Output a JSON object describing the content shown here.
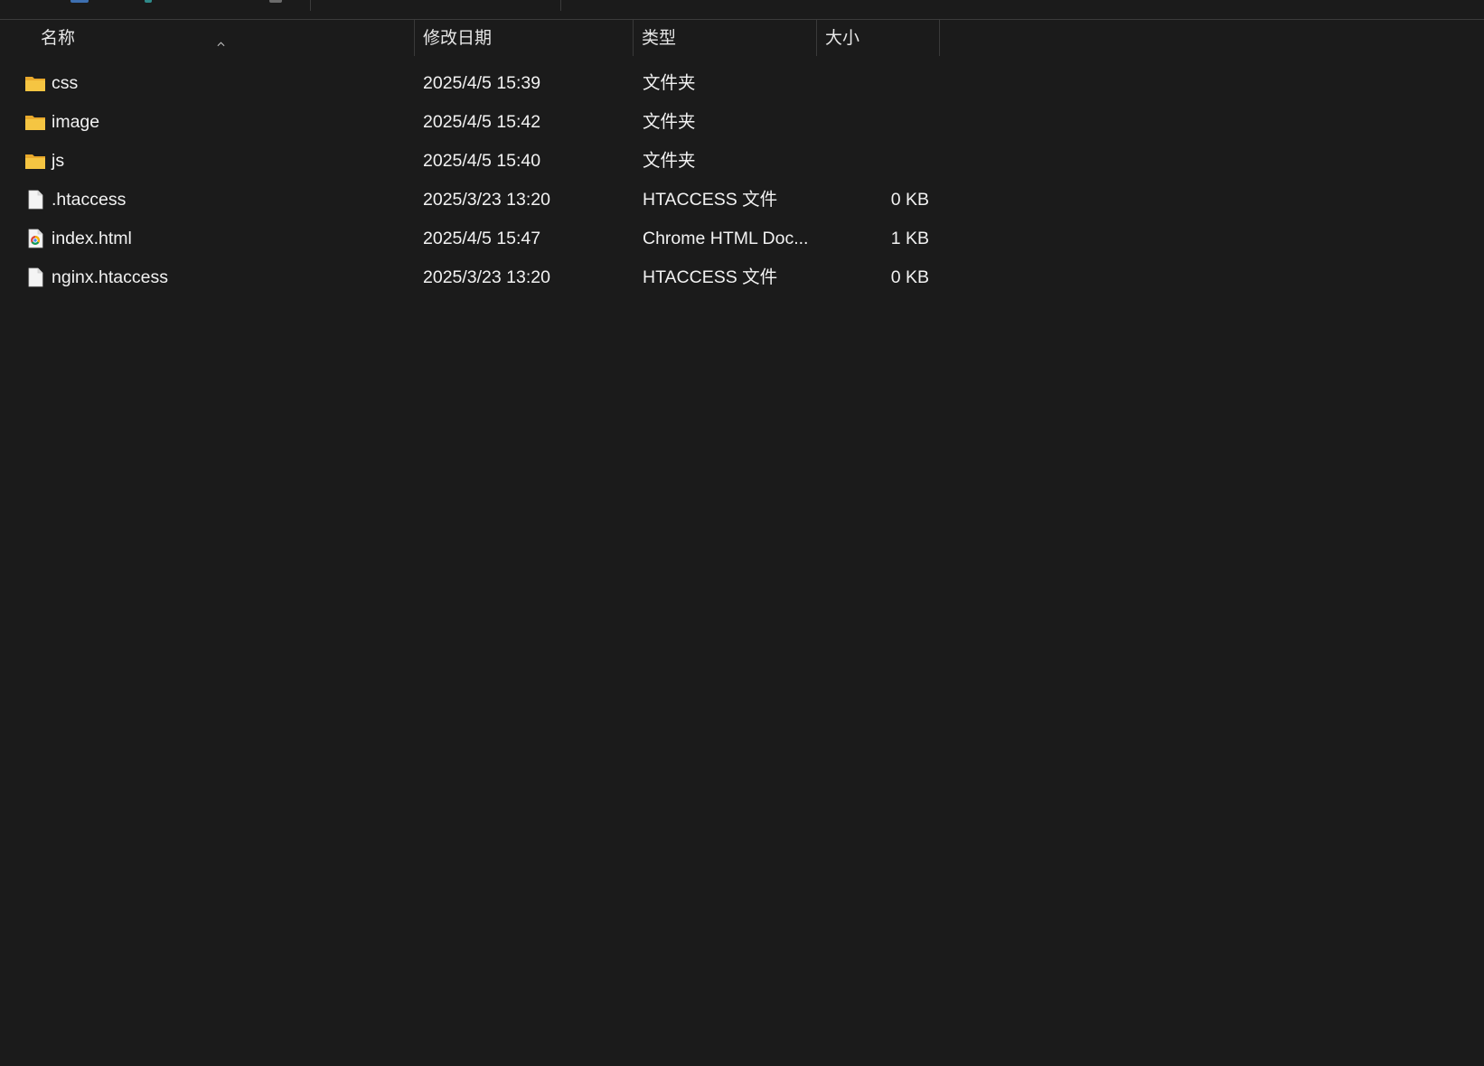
{
  "columns": {
    "name": "名称",
    "modified": "修改日期",
    "type": "类型",
    "size": "大小"
  },
  "files": [
    {
      "icon": "folder-icon",
      "name": "css",
      "modified": "2025/4/5 15:39",
      "type": "文件夹",
      "size": ""
    },
    {
      "icon": "folder-icon",
      "name": "image",
      "modified": "2025/4/5 15:42",
      "type": "文件夹",
      "size": ""
    },
    {
      "icon": "folder-icon",
      "name": "js",
      "modified": "2025/4/5 15:40",
      "type": "文件夹",
      "size": ""
    },
    {
      "icon": "file-icon",
      "name": ".htaccess",
      "modified": "2025/3/23 13:20",
      "type": "HTACCESS 文件",
      "size": "0 KB"
    },
    {
      "icon": "chrome-html-file-icon",
      "name": "index.html",
      "modified": "2025/4/5 15:47",
      "type": "Chrome HTML Doc...",
      "size": "1 KB"
    },
    {
      "icon": "file-icon",
      "name": "nginx.htaccess",
      "modified": "2025/3/23 13:20",
      "type": "HTACCESS 文件",
      "size": "0 KB"
    }
  ],
  "colors": {
    "background": "#1b1b1b",
    "text": "#f2f2f2",
    "folder": "#f5c542",
    "divider": "#3a3a3a"
  }
}
